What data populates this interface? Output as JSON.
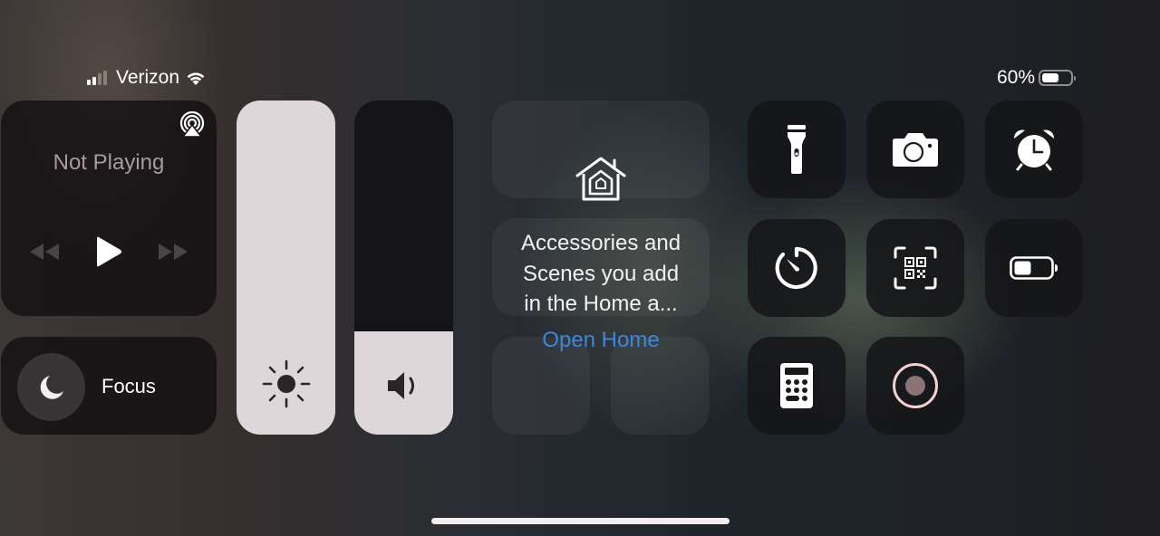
{
  "status_bar": {
    "carrier": "Verizon",
    "signal_bars_active": 2,
    "signal_bars_total": 4,
    "wifi_icon": "wifi-icon",
    "battery_percent_label": "60%",
    "battery_level": 0.6
  },
  "now_playing": {
    "title": "Not Playing",
    "airplay_icon": "airplay-audio-icon",
    "controls": [
      "rewind-icon",
      "play-icon",
      "fast-forward-icon"
    ]
  },
  "focus": {
    "label": "Focus",
    "icon": "moon-icon"
  },
  "sliders": {
    "brightness": {
      "icon": "sun-icon",
      "level": 1.0
    },
    "volume": {
      "icon": "speaker-icon",
      "level": 0.31
    }
  },
  "home": {
    "icon": "home-icon",
    "message": "Accessories and Scenes you add in the Home a...",
    "message_lines": [
      "Accessories and",
      "Scenes you add",
      "in the Home a..."
    ],
    "link_label": "Open Home",
    "link_color": "#3f86d8"
  },
  "controls": [
    {
      "name": "flashlight",
      "icon": "flashlight-icon"
    },
    {
      "name": "camera",
      "icon": "camera-icon"
    },
    {
      "name": "alarm",
      "icon": "alarm-clock-icon"
    },
    {
      "name": "timer",
      "icon": "timer-icon"
    },
    {
      "name": "code-scanner",
      "icon": "qr-code-scanner-icon"
    },
    {
      "name": "low-power-mode",
      "icon": "battery-icon"
    },
    {
      "name": "calculator",
      "icon": "calculator-icon"
    },
    {
      "name": "screen-recording",
      "icon": "record-icon"
    }
  ],
  "colors": {
    "slider_fill": "#ddd7d9",
    "record_ring": "#f3d2d0",
    "record_dot": "#8a7375"
  }
}
